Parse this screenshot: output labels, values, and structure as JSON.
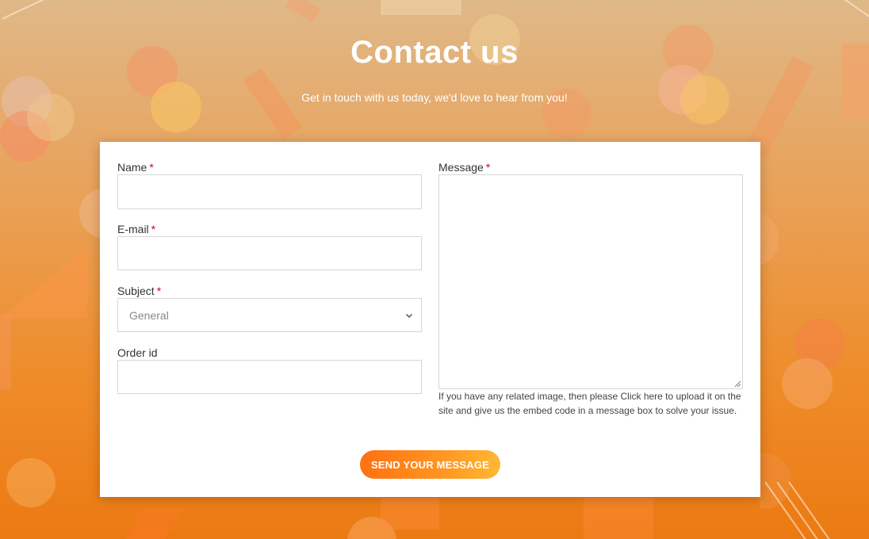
{
  "header": {
    "title": "Contact us",
    "subtitle": "Get in touch with us today, we'd love to hear from you!"
  },
  "form": {
    "name_label": "Name",
    "email_label": "E-mail",
    "subject_label": "Subject",
    "subject_value": "General",
    "order_label": "Order id",
    "message_label": "Message",
    "required_mark": "*",
    "hint_text": "If you have any related image, then please Click here to upload it on the site and give us the embed code in a message box to solve your issue.",
    "submit_label": "SEND YOUR MESSAGE"
  },
  "colors": {
    "accent_start": "#ff7012",
    "accent_end": "#ffb833",
    "required": "#d0021b"
  },
  "icons": {
    "select": "chevron-down-icon",
    "textarea": "resize-handle-icon"
  }
}
